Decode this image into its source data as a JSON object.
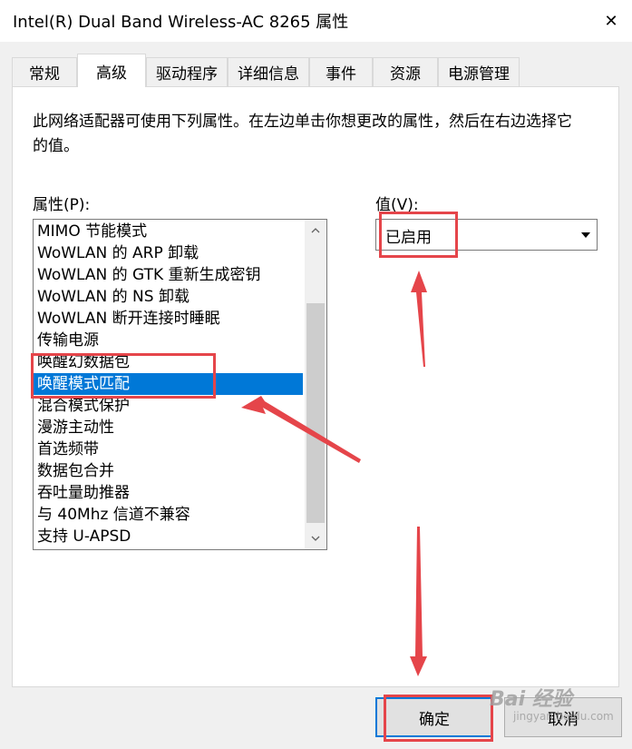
{
  "window": {
    "title": "Intel(R) Dual Band Wireless-AC 8265 属性",
    "close_glyph": "✕"
  },
  "tabs": [
    {
      "label": "常规"
    },
    {
      "label": "高级"
    },
    {
      "label": "驱动程序"
    },
    {
      "label": "详细信息"
    },
    {
      "label": "事件"
    },
    {
      "label": "资源"
    },
    {
      "label": "电源管理"
    }
  ],
  "active_tab": "高级",
  "description": "此网络适配器可使用下列属性。在左边单击你想更改的属性，然后在右边选择它的值。",
  "properties": {
    "label": "属性(P):",
    "items": [
      "MIMO 节能模式",
      "WoWLAN 的 ARP 卸载",
      "WoWLAN 的 GTK 重新生成密钥",
      "WoWLAN 的 NS 卸载",
      "WoWLAN 断开连接时睡眠",
      "传输电源",
      "唤醒幻数据包",
      "唤醒模式匹配",
      "混合模式保护",
      "漫游主动性",
      "首选频带",
      "数据包合并",
      "吞吐量助推器",
      "与 40Mhz 信道不兼容",
      "支持 U-APSD"
    ],
    "selected": "唤醒模式匹配"
  },
  "value": {
    "label": "值(V):",
    "selected": "已启用"
  },
  "buttons": {
    "ok": "确定",
    "cancel": "取消"
  },
  "watermark": {
    "main": "Bai 经验",
    "sub": "jingyan.baidu.com"
  },
  "colors": {
    "selection": "#0078d7",
    "annotation": "#e5454a"
  }
}
